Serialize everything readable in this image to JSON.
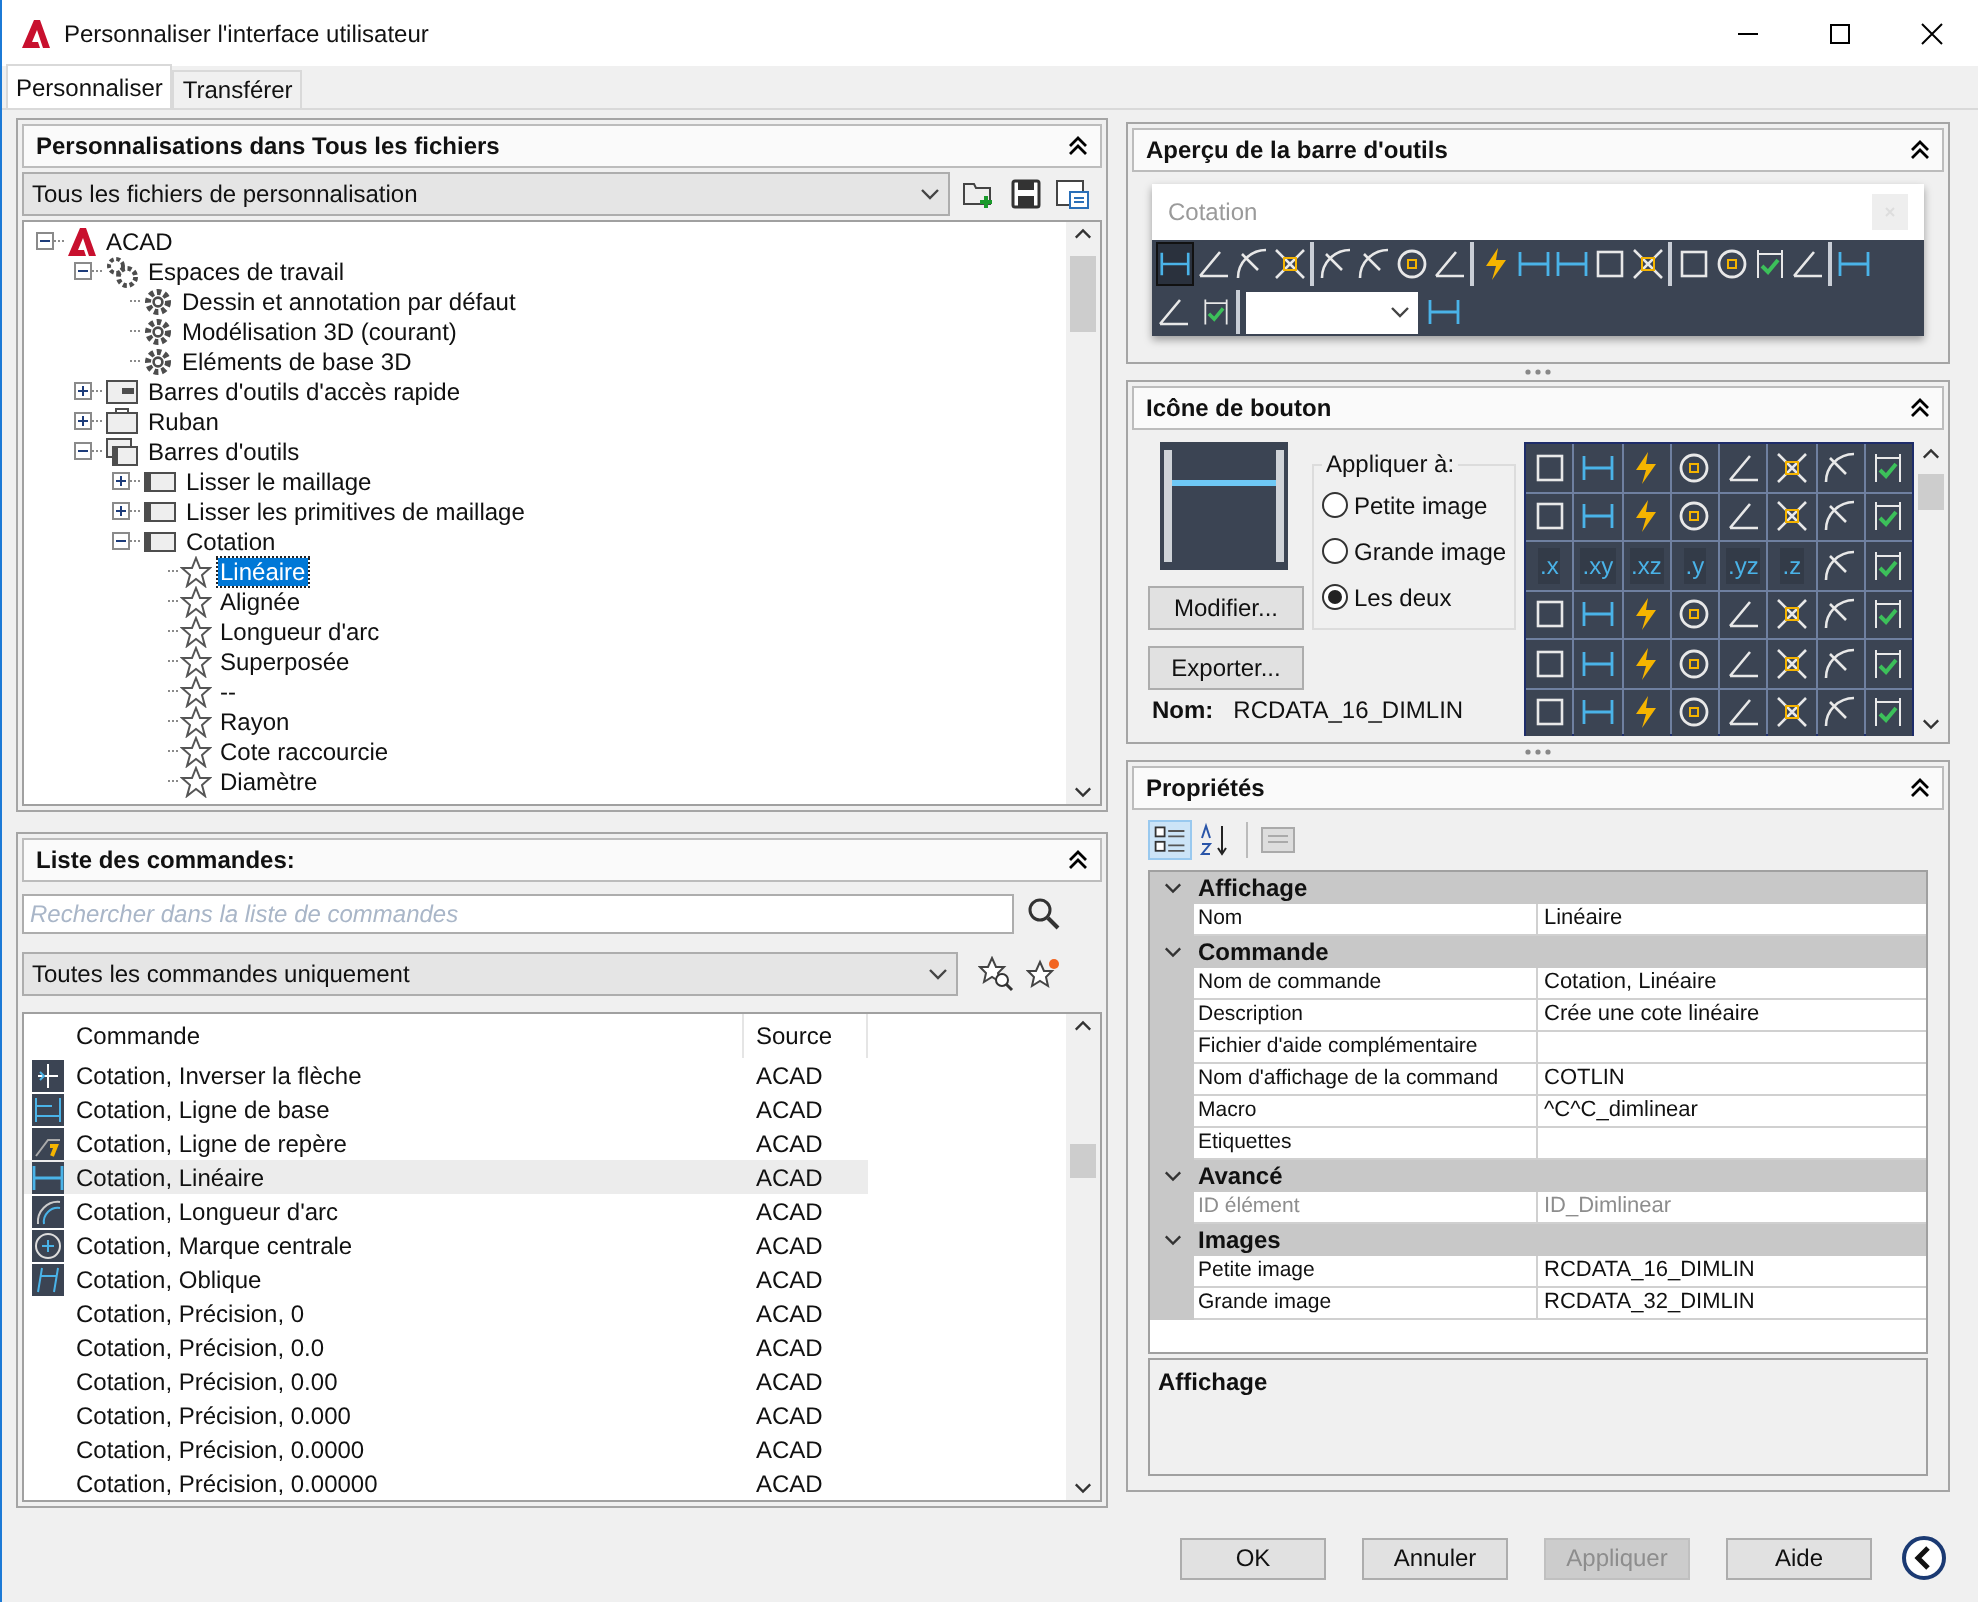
{
  "window": {
    "title": "Personnaliser l'interface utilisateur"
  },
  "tabs": [
    {
      "label": "Personnaliser",
      "selected": true
    },
    {
      "label": "Transférer",
      "selected": false
    }
  ],
  "customizations": {
    "title": "Personnalisations dans Tous les fichiers",
    "file_filter": "Tous les fichiers de personnalisation",
    "tree": [
      {
        "label": "ACAD",
        "kind": "acad",
        "expanded": true,
        "selected": false,
        "children": [
          {
            "label": "Espaces de travail",
            "kind": "workspaces",
            "expanded": true,
            "selected": false,
            "children": [
              {
                "label": "Dessin et annotation par défaut",
                "kind": "workspace",
                "selected": false
              },
              {
                "label": "Modélisation 3D (courant)",
                "kind": "workspace",
                "selected": false
              },
              {
                "label": "Eléments de base 3D",
                "kind": "workspace",
                "selected": false
              }
            ]
          },
          {
            "label": "Barres d'outils d'accès rapide",
            "kind": "quickaccess",
            "expanded": false,
            "selected": false
          },
          {
            "label": "Ruban",
            "kind": "ribbon",
            "expanded": false,
            "selected": false
          },
          {
            "label": "Barres d'outils",
            "kind": "toolbars",
            "expanded": true,
            "selected": false,
            "children": [
              {
                "label": "Lisser le maillage",
                "kind": "toolbar",
                "expanded": false,
                "selected": false
              },
              {
                "label": "Lisser les primitives de maillage",
                "kind": "toolbar",
                "expanded": false,
                "selected": false
              },
              {
                "label": "Cotation",
                "kind": "toolbar",
                "expanded": true,
                "selected": false,
                "children": [
                  {
                    "label": "Linéaire",
                    "kind": "command",
                    "selected": true
                  },
                  {
                    "label": "Alignée",
                    "kind": "command",
                    "selected": false
                  },
                  {
                    "label": "Longueur d'arc",
                    "kind": "command",
                    "selected": false
                  },
                  {
                    "label": "Superposée",
                    "kind": "command",
                    "selected": false
                  },
                  {
                    "label": "--",
                    "kind": "command",
                    "selected": false
                  },
                  {
                    "label": "Rayon",
                    "kind": "command",
                    "selected": false
                  },
                  {
                    "label": "Cote raccourcie",
                    "kind": "command",
                    "selected": false
                  },
                  {
                    "label": "Diamètre",
                    "kind": "command",
                    "selected": false
                  }
                ]
              }
            ]
          }
        ]
      }
    ]
  },
  "commands": {
    "title": "Liste des commandes:",
    "search": {
      "placeholder": "Rechercher dans la liste de commandes"
    },
    "filter": "Toutes les commandes uniquement",
    "columns": [
      "Commande",
      "Source"
    ],
    "rows": [
      {
        "command": "Cotation, Inverser la flèche",
        "source": "ACAD",
        "kind": "flip",
        "selected": false
      },
      {
        "command": "Cotation, Ligne de base",
        "source": "ACAD",
        "kind": "baseline",
        "selected": false
      },
      {
        "command": "Cotation, Ligne de repère",
        "source": "ACAD",
        "kind": "leader",
        "selected": false
      },
      {
        "command": "Cotation, Linéaire",
        "source": "ACAD",
        "kind": "linear",
        "selected": true
      },
      {
        "command": "Cotation, Longueur d'arc",
        "source": "ACAD",
        "kind": "arc",
        "selected": false
      },
      {
        "command": "Cotation, Marque centrale",
        "source": "ACAD",
        "kind": "center",
        "selected": false
      },
      {
        "command": "Cotation, Oblique",
        "source": "ACAD",
        "kind": "oblique",
        "selected": false
      },
      {
        "command": "Cotation, Précision, 0",
        "source": "ACAD",
        "kind": "plain",
        "selected": false
      },
      {
        "command": "Cotation, Précision, 0.0",
        "source": "ACAD",
        "kind": "plain",
        "selected": false
      },
      {
        "command": "Cotation, Précision, 0.00",
        "source": "ACAD",
        "kind": "plain",
        "selected": false
      },
      {
        "command": "Cotation, Précision, 0.000",
        "source": "ACAD",
        "kind": "plain",
        "selected": false
      },
      {
        "command": "Cotation, Précision, 0.0000",
        "source": "ACAD",
        "kind": "plain",
        "selected": false
      },
      {
        "command": "Cotation, Précision, 0.00000",
        "source": "ACAD",
        "kind": "plain",
        "selected": false
      }
    ]
  },
  "toolbar_preview": {
    "title": "Aperçu de la barre d'outils",
    "toolbar_name": "Cotation"
  },
  "button_image": {
    "title": "Icône de bouton",
    "apply_to": {
      "title": "Appliquer à:",
      "options": [
        {
          "label": "Petite image",
          "selected": false
        },
        {
          "label": "Grande image",
          "selected": false
        },
        {
          "label": "Les deux",
          "selected": true
        }
      ]
    },
    "buttons": [
      "Modifier...",
      "Exporter..."
    ],
    "name_label": "Nom:",
    "name_value": "RCDATA_16_DIMLIN",
    "cells": [
      {
        "kind": "icon"
      },
      {
        "kind": "icon"
      },
      {
        "kind": "icon"
      },
      {
        "kind": "icon"
      },
      {
        "kind": "icon"
      },
      {
        "kind": "icon"
      },
      {
        "kind": "icon"
      },
      {
        "kind": "icon"
      },
      {
        "kind": "icon"
      },
      {
        "kind": "icon"
      },
      {
        "kind": "icon"
      },
      {
        "kind": "icon"
      },
      {
        "kind": "icon"
      },
      {
        "kind": "icon"
      },
      {
        "kind": "icon"
      },
      {
        "kind": "icon"
      },
      {
        "kind": "text",
        "label": ".x"
      },
      {
        "kind": "text",
        "label": ".xy"
      },
      {
        "kind": "text",
        "label": ".xz"
      },
      {
        "kind": "text",
        "label": ".y"
      },
      {
        "kind": "text",
        "label": ".yz"
      },
      {
        "kind": "text",
        "label": ".z"
      },
      {
        "kind": "icon"
      },
      {
        "kind": "icon"
      },
      {
        "kind": "icon"
      },
      {
        "kind": "icon"
      },
      {
        "kind": "icon"
      },
      {
        "kind": "icon"
      },
      {
        "kind": "icon"
      },
      {
        "kind": "icon"
      },
      {
        "kind": "icon"
      },
      {
        "kind": "icon"
      },
      {
        "kind": "icon"
      },
      {
        "kind": "icon"
      },
      {
        "kind": "icon"
      },
      {
        "kind": "icon"
      },
      {
        "kind": "icon"
      },
      {
        "kind": "icon"
      },
      {
        "kind": "icon"
      },
      {
        "kind": "icon"
      },
      {
        "kind": "icon"
      },
      {
        "kind": "icon"
      },
      {
        "kind": "icon"
      },
      {
        "kind": "icon"
      },
      {
        "kind": "icon"
      },
      {
        "kind": "icon"
      },
      {
        "kind": "icon"
      },
      {
        "kind": "icon"
      }
    ]
  },
  "properties": {
    "title": "Propriétés",
    "categories": [
      {
        "name": "Affichage",
        "expanded": true,
        "rows": [
          {
            "name": "Nom",
            "value": "Linéaire",
            "disabled": false
          }
        ]
      },
      {
        "name": "Commande",
        "expanded": true,
        "rows": [
          {
            "name": "Nom de commande",
            "value": "Cotation, Linéaire",
            "disabled": false
          },
          {
            "name": "Description",
            "value": "Crée une cote linéaire",
            "disabled": false
          },
          {
            "name": "Fichier d'aide complémentaire",
            "disabled": false
          },
          {
            "name": "Nom d'affichage de la command",
            "value": "COTLIN",
            "disabled": false
          },
          {
            "name": "Macro",
            "value": "^C^C_dimlinear",
            "disabled": false
          },
          {
            "name": "Etiquettes",
            "disabled": false
          }
        ]
      },
      {
        "name": "Avancé",
        "expanded": true,
        "rows": [
          {
            "name": "ID élément",
            "value": "ID_Dimlinear",
            "disabled": true
          }
        ]
      },
      {
        "name": "Images",
        "expanded": true,
        "rows": [
          {
            "name": "Petite image",
            "value": "RCDATA_16_DIMLIN",
            "disabled": false
          },
          {
            "name": "Grande image",
            "value": "RCDATA_32_DIMLIN",
            "disabled": false
          }
        ]
      }
    ],
    "description_title": "Affichage"
  },
  "footer_buttons": [
    {
      "label": "OK",
      "disabled": false
    },
    {
      "label": "Annuler",
      "disabled": false
    },
    {
      "label": "Appliquer",
      "disabled": true
    },
    {
      "label": "Aide",
      "disabled": false
    }
  ]
}
